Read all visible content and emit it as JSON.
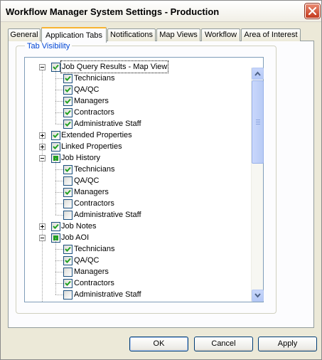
{
  "window": {
    "title": "Workflow Manager System Settings - Production"
  },
  "tabs": [
    {
      "label": "General",
      "active": false
    },
    {
      "label": "Application Tabs",
      "active": true
    },
    {
      "label": "Notifications",
      "active": false
    },
    {
      "label": "Map Views",
      "active": false
    },
    {
      "label": "Workflow",
      "active": false
    },
    {
      "label": "Area of Interest",
      "active": false
    }
  ],
  "group": {
    "title": "Tab Visibility"
  },
  "tree": [
    {
      "label": "Job Query Results - Map View",
      "level": 0,
      "expander": "minus",
      "state": "checked",
      "focused": true
    },
    {
      "label": "Technicians",
      "level": 1,
      "state": "checked"
    },
    {
      "label": "QA/QC",
      "level": 1,
      "state": "checked"
    },
    {
      "label": "Managers",
      "level": 1,
      "state": "checked"
    },
    {
      "label": "Contractors",
      "level": 1,
      "state": "checked"
    },
    {
      "label": "Administrative Staff",
      "level": 1,
      "state": "checked"
    },
    {
      "label": "Extended Properties",
      "level": 0,
      "expander": "plus",
      "state": "checked"
    },
    {
      "label": "Linked Properties",
      "level": 0,
      "expander": "plus",
      "state": "checked"
    },
    {
      "label": "Job History",
      "level": 0,
      "expander": "minus",
      "state": "partial"
    },
    {
      "label": "Technicians",
      "level": 1,
      "state": "checked"
    },
    {
      "label": "QA/QC",
      "level": 1,
      "state": "unchecked"
    },
    {
      "label": "Managers",
      "level": 1,
      "state": "checked"
    },
    {
      "label": "Contractors",
      "level": 1,
      "state": "unchecked"
    },
    {
      "label": "Administrative Staff",
      "level": 1,
      "state": "unchecked"
    },
    {
      "label": "Job Notes",
      "level": 0,
      "expander": "plus",
      "state": "checked"
    },
    {
      "label": "Job AOI",
      "level": 0,
      "expander": "minus",
      "state": "partial"
    },
    {
      "label": "Technicians",
      "level": 1,
      "state": "checked"
    },
    {
      "label": "QA/QC",
      "level": 1,
      "state": "checked"
    },
    {
      "label": "Managers",
      "level": 1,
      "state": "unchecked"
    },
    {
      "label": "Contractors",
      "level": 1,
      "state": "checked"
    },
    {
      "label": "Administrative Staff",
      "level": 1,
      "state": "unchecked"
    }
  ],
  "buttons": {
    "ok": "OK",
    "cancel": "Cancel",
    "apply": "Apply"
  },
  "colors": {
    "accent_tab": "#f8b330",
    "group_label": "#0046d5",
    "check": "#21a121"
  },
  "icons": {
    "close": "close-icon",
    "scroll_up": "arrow-up-icon",
    "scroll_down": "arrow-down-icon",
    "check": "check-icon"
  }
}
